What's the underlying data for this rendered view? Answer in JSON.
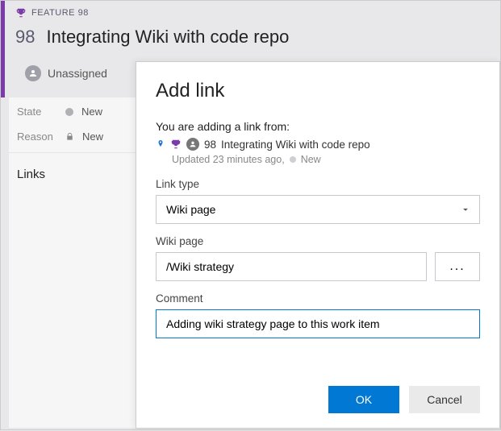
{
  "header": {
    "type_label": "FEATURE 98",
    "id": "98",
    "title": "Integrating Wiki with code repo",
    "assignee": "Unassigned"
  },
  "side": {
    "state_label": "State",
    "state_value": "New",
    "reason_label": "Reason",
    "reason_value": "New",
    "links_heading": "Links"
  },
  "dialog": {
    "title": "Add link",
    "context_text": "You are adding a link from:",
    "item_id": "98",
    "item_title": "Integrating Wiki with code repo",
    "updated_text": "Updated 23 minutes ago,",
    "item_state": "New",
    "link_type_label": "Link type",
    "link_type_value": "Wiki page",
    "wiki_page_label": "Wiki page",
    "wiki_page_value": "/Wiki strategy",
    "browse_label": "...",
    "comment_label": "Comment",
    "comment_value": "Adding wiki strategy page to this work item",
    "ok_label": "OK",
    "cancel_label": "Cancel"
  }
}
